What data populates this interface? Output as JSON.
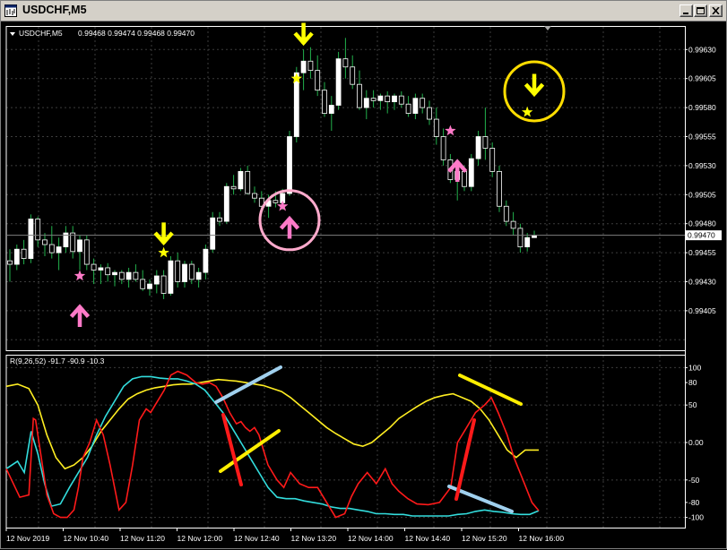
{
  "window": {
    "title": "USDCHF,M5"
  },
  "main_header": {
    "symbol": "USDCHF,M5",
    "ohlc": "0.99468 0.99474 0.99468 0.99470"
  },
  "price_axis": {
    "ticks": [
      "0.99630",
      "0.99605",
      "0.99580",
      "0.99555",
      "0.99530",
      "0.99505",
      "0.99480",
      "0.99455",
      "0.99430",
      "0.99405"
    ],
    "current_price": "0.99470"
  },
  "indicator": {
    "label": "R(9,26,52) -91.7 -90.9 -10.3",
    "ticks": [
      "100",
      "80",
      "50",
      "0.00",
      "-50",
      "-80",
      "-100"
    ]
  },
  "time_axis": {
    "labels": [
      "12 Nov 2019",
      "12 Nov 10:40",
      "12 Nov 11:20",
      "12 Nov 12:00",
      "12 Nov 12:40",
      "12 Nov 13:20",
      "12 Nov 14:00",
      "12 Nov 14:40",
      "12 Nov 15:20",
      "12 Nov 16:00"
    ]
  },
  "colors": {
    "background": "#000000",
    "grid": "#3c3c3c",
    "candle": "#ffffff",
    "wick": "#22b14c",
    "price_line": "#7f7f7f",
    "sell_arrow": "#ffff00",
    "buy_arrow": "#ff7ac8",
    "sell_star": "#ffff00",
    "buy_star": "#ff7ac8",
    "osc_fast": "#ff1a1a",
    "osc_mid": "#33dddd",
    "osc_slow": "#ffee22",
    "annot_blue": "#a0d0ee",
    "annot_yellow": "#ffee00",
    "annot_red": "#ff1a1a",
    "circle_pink": "#ffaacc",
    "circle_yellow": "#ffdd00"
  },
  "chart_data": {
    "type": "candlestick",
    "symbol": "USDCHF",
    "timeframe": "M5",
    "y_range": [
      0.994,
      0.9965
    ],
    "candles": [
      [
        0.99448,
        0.99458,
        0.9943,
        0.99445
      ],
      [
        0.99445,
        0.99462,
        0.9944,
        0.99458
      ],
      [
        0.99458,
        0.99466,
        0.99445,
        0.9945
      ],
      [
        0.9945,
        0.99488,
        0.99446,
        0.99484
      ],
      [
        0.99484,
        0.99486,
        0.9946,
        0.99466
      ],
      [
        0.99466,
        0.99472,
        0.99452,
        0.99462
      ],
      [
        0.99462,
        0.99478,
        0.9945,
        0.99455
      ],
      [
        0.99455,
        0.99468,
        0.9944,
        0.9946
      ],
      [
        0.9946,
        0.99478,
        0.99455,
        0.99472
      ],
      [
        0.99472,
        0.99478,
        0.9945,
        0.99456
      ],
      [
        0.99456,
        0.9947,
        0.9944,
        0.99466
      ],
      [
        0.99466,
        0.9947,
        0.9944,
        0.99445
      ],
      [
        0.99445,
        0.9945,
        0.99428,
        0.9944
      ],
      [
        0.9944,
        0.99445,
        0.99428,
        0.99442
      ],
      [
        0.99442,
        0.99446,
        0.9943,
        0.99436
      ],
      [
        0.99436,
        0.9944,
        0.99426,
        0.99438
      ],
      [
        0.99438,
        0.9944,
        0.99428,
        0.99432
      ],
      [
        0.99432,
        0.99442,
        0.99425,
        0.99438
      ],
      [
        0.99438,
        0.99445,
        0.9943,
        0.99432
      ],
      [
        0.99432,
        0.9944,
        0.99422,
        0.99424
      ],
      [
        0.99424,
        0.99432,
        0.99418,
        0.99428
      ],
      [
        0.99428,
        0.9944,
        0.9942,
        0.99435
      ],
      [
        0.99435,
        0.9944,
        0.99415,
        0.9942
      ],
      [
        0.9942,
        0.99452,
        0.99418,
        0.99448
      ],
      [
        0.99448,
        0.99455,
        0.99425,
        0.9943
      ],
      [
        0.9943,
        0.99448,
        0.99425,
        0.99445
      ],
      [
        0.99445,
        0.99448,
        0.99428,
        0.99432
      ],
      [
        0.99432,
        0.99442,
        0.99425,
        0.99438
      ],
      [
        0.99438,
        0.99462,
        0.99432,
        0.99458
      ],
      [
        0.99458,
        0.9949,
        0.99455,
        0.99485
      ],
      [
        0.99485,
        0.9949,
        0.99478,
        0.99482
      ],
      [
        0.99482,
        0.99515,
        0.9948,
        0.99512
      ],
      [
        0.99512,
        0.99522,
        0.99505,
        0.9951
      ],
      [
        0.9951,
        0.99528,
        0.99508,
        0.99525
      ],
      [
        0.99525,
        0.9953,
        0.99505,
        0.99506
      ],
      [
        0.99506,
        0.99512,
        0.99498,
        0.99502
      ],
      [
        0.99502,
        0.99508,
        0.9949,
        0.99495
      ],
      [
        0.99495,
        0.99505,
        0.99485,
        0.995
      ],
      [
        0.995,
        0.99508,
        0.99494,
        0.99498
      ],
      [
        0.99498,
        0.9951,
        0.99492,
        0.99506
      ],
      [
        0.99506,
        0.9956,
        0.99504,
        0.99555
      ],
      [
        0.99555,
        0.99615,
        0.9955,
        0.9961
      ],
      [
        0.9961,
        0.9963,
        0.99595,
        0.9962
      ],
      [
        0.9962,
        0.99632,
        0.99605,
        0.99612
      ],
      [
        0.99612,
        0.99625,
        0.9959,
        0.99595
      ],
      [
        0.99595,
        0.99602,
        0.99572,
        0.99575
      ],
      [
        0.99575,
        0.9959,
        0.9956,
        0.99582
      ],
      [
        0.99582,
        0.99628,
        0.99578,
        0.99622
      ],
      [
        0.99622,
        0.9964,
        0.99605,
        0.99615
      ],
      [
        0.99615,
        0.99625,
        0.99596,
        0.996
      ],
      [
        0.996,
        0.99612,
        0.99578,
        0.9958
      ],
      [
        0.9958,
        0.99595,
        0.9957,
        0.99588
      ],
      [
        0.99588,
        0.99595,
        0.9958,
        0.99586
      ],
      [
        0.99586,
        0.99592,
        0.99578,
        0.9959
      ],
      [
        0.9959,
        0.99594,
        0.99575,
        0.99585
      ],
      [
        0.99585,
        0.99592,
        0.99578,
        0.9959
      ],
      [
        0.9959,
        0.99594,
        0.9958,
        0.99583
      ],
      [
        0.99583,
        0.9959,
        0.99572,
        0.99575
      ],
      [
        0.99575,
        0.99592,
        0.9957,
        0.99588
      ],
      [
        0.99588,
        0.99592,
        0.99575,
        0.9958
      ],
      [
        0.9958,
        0.99586,
        0.99565,
        0.9957
      ],
      [
        0.9957,
        0.9958,
        0.99548,
        0.99555
      ],
      [
        0.99555,
        0.99562,
        0.9953,
        0.99535
      ],
      [
        0.99535,
        0.9954,
        0.99515,
        0.99518
      ],
      [
        0.99518,
        0.99532,
        0.995,
        0.99525
      ],
      [
        0.99525,
        0.9953,
        0.99508,
        0.99512
      ],
      [
        0.99512,
        0.9954,
        0.99508,
        0.99536
      ],
      [
        0.99536,
        0.9956,
        0.9953,
        0.99555
      ],
      [
        0.99555,
        0.9958,
        0.99535,
        0.99545
      ],
      [
        0.99545,
        0.9955,
        0.9952,
        0.99525
      ],
      [
        0.99525,
        0.9953,
        0.9949,
        0.99495
      ],
      [
        0.99495,
        0.995,
        0.99478,
        0.99482
      ],
      [
        0.99482,
        0.9949,
        0.9947,
        0.99476
      ],
      [
        0.99476,
        0.9948,
        0.99455,
        0.9946
      ],
      [
        0.9946,
        0.99472,
        0.99456,
        0.99468
      ],
      [
        0.99468,
        0.99474,
        0.99468,
        0.9947
      ]
    ],
    "signals": [
      {
        "type": "buy_arrow",
        "i": 10,
        "price": 0.99402
      },
      {
        "type": "buy_star",
        "i": 10,
        "price": 0.99435
      },
      {
        "type": "sell_arrow",
        "i": 22,
        "price": 0.9947
      },
      {
        "type": "sell_star",
        "i": 22,
        "price": 0.99455
      },
      {
        "type": "buy_star",
        "i": 39,
        "price": 0.99495
      },
      {
        "type": "buy_arrow",
        "i": 40,
        "price": 0.99478
      },
      {
        "type": "sell_star",
        "i": 41,
        "price": 0.99605
      },
      {
        "type": "sell_arrow",
        "i": 42,
        "price": 0.99642
      },
      {
        "type": "buy_star",
        "i": 63,
        "price": 0.9956
      },
      {
        "type": "buy_arrow",
        "i": 64,
        "price": 0.99527
      },
      {
        "type": "sell_star",
        "i": 74,
        "price": 0.99576
      },
      {
        "type": "sell_arrow",
        "i": 75,
        "price": 0.99598
      }
    ],
    "circles": [
      {
        "i": 40,
        "price": 0.99483,
        "r": 33,
        "color": "circle_pink"
      },
      {
        "i": 75,
        "price": 0.99594,
        "r": 33,
        "color": "circle_yellow"
      }
    ],
    "indicator": {
      "name": "R(9,26,52)",
      "y_range": [
        -110,
        110
      ],
      "fast": [
        [
          0,
          -35
        ],
        [
          6,
          -73
        ],
        [
          10,
          -70
        ],
        [
          12,
          32
        ],
        [
          13,
          30
        ],
        [
          16,
          -30
        ],
        [
          18,
          -70
        ],
        [
          21,
          -95
        ],
        [
          24,
          -100
        ],
        [
          27,
          -100
        ],
        [
          30,
          -90
        ],
        [
          32,
          -60
        ],
        [
          34,
          -20
        ],
        [
          37,
          0
        ],
        [
          40,
          30
        ],
        [
          43,
          10
        ],
        [
          46,
          -30
        ],
        [
          50,
          -90
        ],
        [
          53,
          -80
        ],
        [
          56,
          -30
        ],
        [
          59,
          30
        ],
        [
          62,
          45
        ],
        [
          64,
          40
        ],
        [
          66,
          50
        ],
        [
          70,
          70
        ],
        [
          73,
          90
        ],
        [
          76,
          95
        ],
        [
          80,
          90
        ],
        [
          84,
          80
        ],
        [
          87,
          78
        ],
        [
          90,
          80
        ],
        [
          93,
          75
        ],
        [
          96,
          60
        ],
        [
          99,
          40
        ],
        [
          102,
          25
        ],
        [
          104,
          28
        ],
        [
          106,
          20
        ],
        [
          108,
          15
        ],
        [
          110,
          20
        ],
        [
          112,
          10
        ],
        [
          114,
          -10
        ],
        [
          116,
          -30
        ],
        [
          118,
          -40
        ],
        [
          120,
          -50
        ],
        [
          123,
          -60
        ],
        [
          126,
          -40
        ],
        [
          130,
          -55
        ],
        [
          134,
          -60
        ],
        [
          138,
          -60
        ],
        [
          142,
          -80
        ],
        [
          146,
          -100
        ],
        [
          150,
          -95
        ],
        [
          153,
          -72
        ],
        [
          156,
          -55
        ],
        [
          160,
          -40
        ],
        [
          164,
          -55
        ],
        [
          168,
          -35
        ],
        [
          171,
          -55
        ],
        [
          174,
          -65
        ],
        [
          178,
          -75
        ],
        [
          182,
          -82
        ],
        [
          187,
          -83
        ],
        [
          192,
          -80
        ],
        [
          197,
          -60
        ],
        [
          200,
          0
        ],
        [
          204,
          20
        ],
        [
          208,
          40
        ],
        [
          212,
          50
        ],
        [
          215,
          60
        ],
        [
          218,
          40
        ],
        [
          222,
          10
        ],
        [
          225,
          -20
        ],
        [
          229,
          -50
        ],
        [
          233,
          -80
        ],
        [
          236,
          -91
        ]
      ],
      "mid": [
        [
          0,
          -35
        ],
        [
          5,
          -25
        ],
        [
          8,
          -40
        ],
        [
          11,
          15
        ],
        [
          14,
          -15
        ],
        [
          17,
          -55
        ],
        [
          20,
          -85
        ],
        [
          24,
          -82
        ],
        [
          28,
          -60
        ],
        [
          32,
          -40
        ],
        [
          36,
          -20
        ],
        [
          40,
          10
        ],
        [
          44,
          35
        ],
        [
          48,
          55
        ],
        [
          52,
          75
        ],
        [
          56,
          85
        ],
        [
          60,
          88
        ],
        [
          64,
          88
        ],
        [
          68,
          86
        ],
        [
          72,
          85
        ],
        [
          76,
          85
        ],
        [
          80,
          82
        ],
        [
          84,
          78
        ],
        [
          88,
          70
        ],
        [
          92,
          55
        ],
        [
          96,
          40
        ],
        [
          100,
          20
        ],
        [
          104,
          0
        ],
        [
          108,
          -20
        ],
        [
          112,
          -40
        ],
        [
          116,
          -60
        ],
        [
          120,
          -73
        ],
        [
          124,
          -75
        ],
        [
          128,
          -75
        ],
        [
          132,
          -78
        ],
        [
          136,
          -80
        ],
        [
          140,
          -82
        ],
        [
          144,
          -86
        ],
        [
          148,
          -88
        ],
        [
          152,
          -88
        ],
        [
          156,
          -90
        ],
        [
          160,
          -92
        ],
        [
          164,
          -95
        ],
        [
          168,
          -95
        ],
        [
          172,
          -96
        ],
        [
          176,
          -96
        ],
        [
          180,
          -98
        ],
        [
          184,
          -98
        ],
        [
          188,
          -98
        ],
        [
          192,
          -98
        ],
        [
          196,
          -98
        ],
        [
          200,
          -96
        ],
        [
          204,
          -95
        ],
        [
          208,
          -92
        ],
        [
          212,
          -90
        ],
        [
          216,
          -92
        ],
        [
          220,
          -93
        ],
        [
          224,
          -95
        ],
        [
          228,
          -96
        ],
        [
          232,
          -96
        ],
        [
          236,
          -91
        ]
      ],
      "slow": [
        [
          0,
          75
        ],
        [
          5,
          78
        ],
        [
          10,
          72
        ],
        [
          14,
          50
        ],
        [
          18,
          10
        ],
        [
          22,
          -20
        ],
        [
          26,
          -35
        ],
        [
          30,
          -30
        ],
        [
          34,
          -20
        ],
        [
          38,
          -5
        ],
        [
          42,
          15
        ],
        [
          46,
          30
        ],
        [
          50,
          45
        ],
        [
          54,
          58
        ],
        [
          58,
          65
        ],
        [
          62,
          70
        ],
        [
          66,
          73
        ],
        [
          70,
          75
        ],
        [
          74,
          77
        ],
        [
          78,
          78
        ],
        [
          82,
          78
        ],
        [
          86,
          80
        ],
        [
          90,
          82
        ],
        [
          94,
          84
        ],
        [
          98,
          83
        ],
        [
          102,
          82
        ],
        [
          106,
          80
        ],
        [
          110,
          78
        ],
        [
          114,
          76
        ],
        [
          118,
          72
        ],
        [
          122,
          68
        ],
        [
          126,
          60
        ],
        [
          130,
          50
        ],
        [
          134,
          40
        ],
        [
          138,
          30
        ],
        [
          142,
          20
        ],
        [
          146,
          12
        ],
        [
          150,
          5
        ],
        [
          154,
          -2
        ],
        [
          158,
          -5
        ],
        [
          162,
          0
        ],
        [
          166,
          10
        ],
        [
          170,
          20
        ],
        [
          174,
          32
        ],
        [
          178,
          40
        ],
        [
          182,
          48
        ],
        [
          186,
          55
        ],
        [
          190,
          60
        ],
        [
          194,
          63
        ],
        [
          198,
          65
        ],
        [
          202,
          60
        ],
        [
          206,
          55
        ],
        [
          210,
          45
        ],
        [
          214,
          30
        ],
        [
          218,
          10
        ],
        [
          222,
          -10
        ],
        [
          226,
          -20
        ],
        [
          230,
          -10
        ],
        [
          236,
          -10
        ]
      ]
    }
  }
}
